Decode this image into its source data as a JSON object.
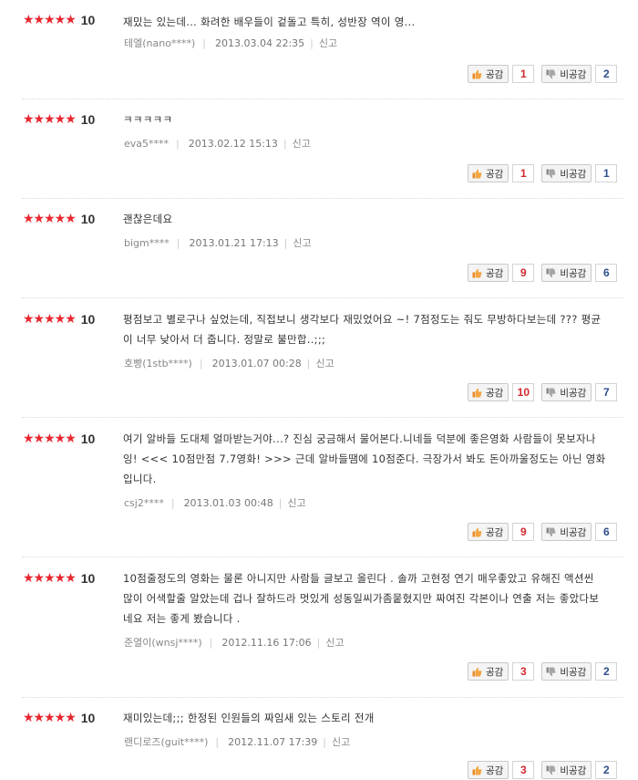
{
  "labels": {
    "like": "공감",
    "dislike": "비공감",
    "report": "신고"
  },
  "reviews": [
    {
      "stars": "★★★★★",
      "score": "10",
      "text": "재밌는 있는데... 화려한 배우들이 겉돌고 특히, 성반장 역이 영...",
      "user": "테엘(nano****)",
      "date": "2013.03.04 22:35",
      "likes": "1",
      "dislikes": "2"
    },
    {
      "stars": "★★★★★",
      "score": "10",
      "text": "ㅋㅋㅋㅋㅋ",
      "user": "eva5****",
      "date": "2013.02.12 15:13",
      "likes": "1",
      "dislikes": "1"
    },
    {
      "stars": "★★★★★",
      "score": "10",
      "text": "괜찮은데요",
      "user": "bigm****",
      "date": "2013.01.21 17:13",
      "likes": "9",
      "dislikes": "6"
    },
    {
      "stars": "★★★★★",
      "score": "10",
      "text": "평점보고 별로구나 싶었는데, 직접보니 생각보다 재밌었어요 ~! 7점정도는 줘도 무방하다보는데 ??? 평균이 너무 낮아서 더 줍니다. 정말로 불만합..;;;",
      "user": "호빵(1stb****)",
      "date": "2013.01.07 00:28",
      "likes": "10",
      "dislikes": "7"
    },
    {
      "stars": "★★★★★",
      "score": "10",
      "text": "여기 알바들 도대체 얼마받는거야...? 진심 궁금해서 물어본다.니네들 덕분에 좋은영화 사람들이 못보자나잉! <<< 10점만점 7.7영화! >>> 근데 알바들땜에 10점준다. 극장가서 봐도 돈아까울정도는 아닌 영화입니다.",
      "user": "csj2****",
      "date": "2013.01.03 00:48",
      "likes": "9",
      "dislikes": "6"
    },
    {
      "stars": "★★★★★",
      "score": "10",
      "text": "10점줄정도의 영화는 물론 아니지만 사람들 글보고 올린다 . 솔까 고현정 연기 매우좋았고 유해진 액션씬 많이 어색할줄 알았는데 겁나 잘하드라 멋있게 성동일씨가좀뭍혔지만 짜여진 각본이나 연출 저는 좋았다보네요 저는 좋게 봤습니다 .",
      "user": "준열이(wnsj****)",
      "date": "2012.11.16 17:06",
      "likes": "3",
      "dislikes": "2"
    },
    {
      "stars": "★★★★★",
      "score": "10",
      "text": "재미있는데;;; 한정된 인원들의 짜임새 있는 스토리 전개",
      "user": "랜디로즈(guit****)",
      "date": "2012.11.07 17:39",
      "likes": "3",
      "dislikes": "2"
    }
  ],
  "colors": {
    "star": "#e8262f",
    "like_count": "#d0282f",
    "dislike_count": "#2b4e8c"
  }
}
